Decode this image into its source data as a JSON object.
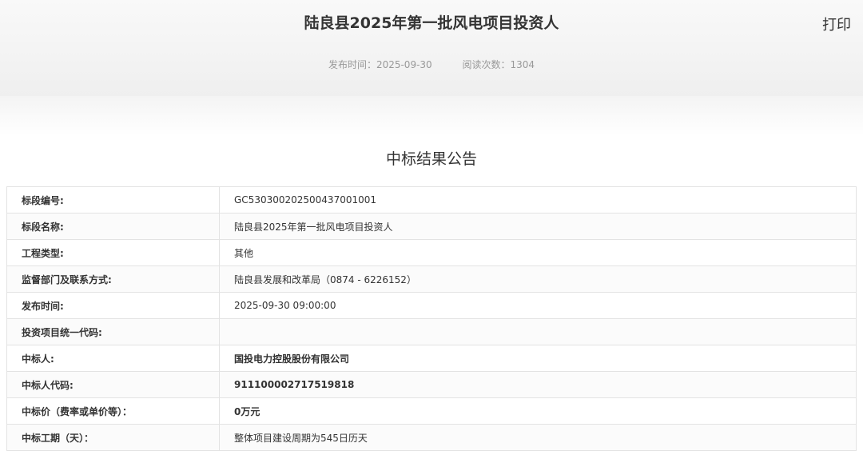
{
  "header": {
    "title": "陆良县2025年第一批风电项目投资人",
    "print_label": "打印",
    "publish_time": "发布时间：2025-09-30",
    "read_count": "阅读次数：1304"
  },
  "section_title": "中标结果公告",
  "rows": [
    {
      "label": "标段编号:",
      "value": "GC530300202500437001001"
    },
    {
      "label": "标段名称:",
      "value": "陆良县2025年第一批风电项目投资人"
    },
    {
      "label": "工程类型:",
      "value": "其他"
    },
    {
      "label": "监督部门及联系方式:",
      "value": "陆良县发展和改革局（0874 - 6226152）"
    },
    {
      "label": "发布时间:",
      "value": "2025-09-30 09:00:00"
    },
    {
      "label": "投资项目统一代码:",
      "value": ""
    },
    {
      "label": "中标人:",
      "value": "国投电力控股股份有限公司"
    },
    {
      "label": "中标人代码:",
      "value": "911100002717519818"
    },
    {
      "label": "中标价（费率或单价等）：",
      "value": "0万元"
    },
    {
      "label": "中标工期（天）：",
      "value": "整体项目建设周期为545日历天"
    }
  ]
}
